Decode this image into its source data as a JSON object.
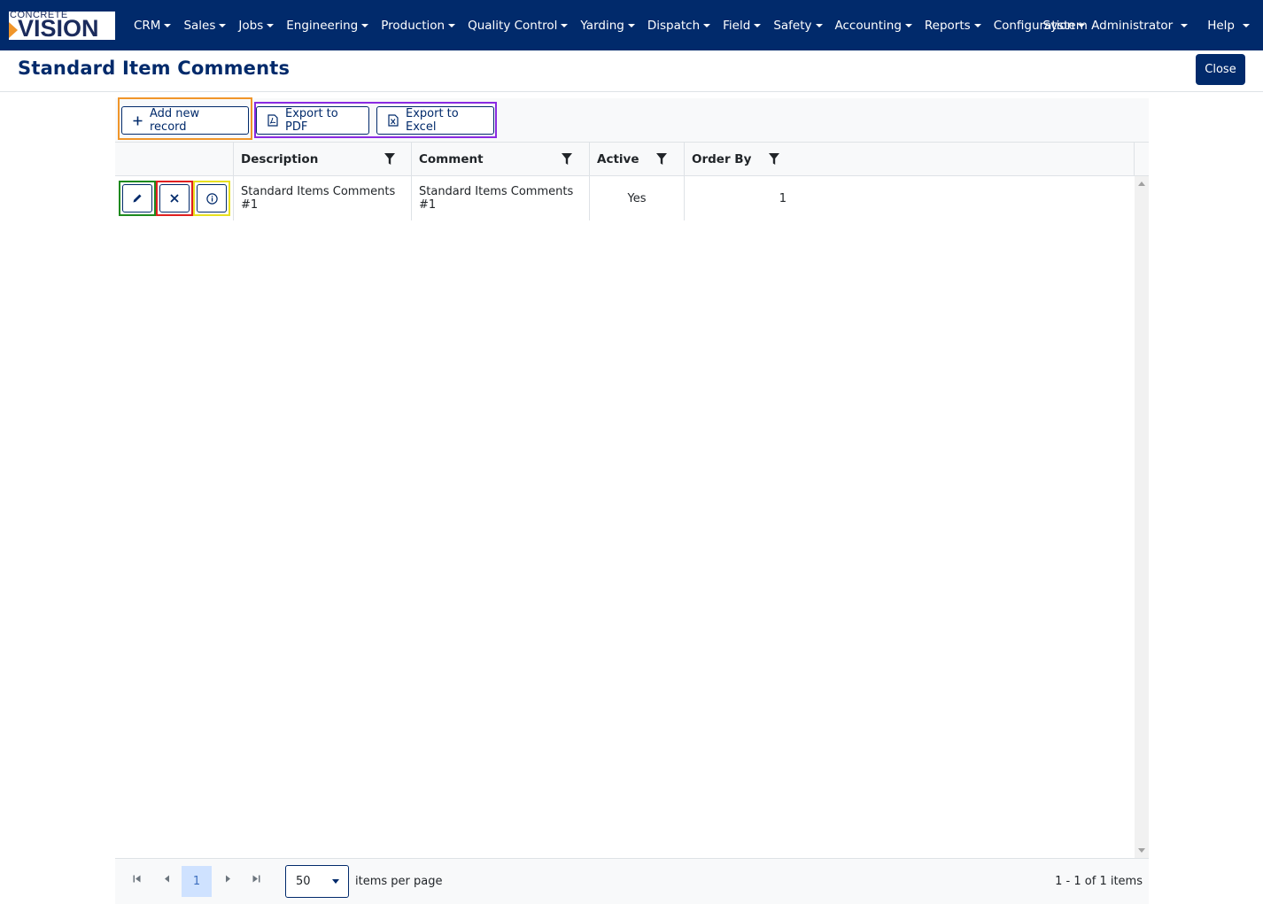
{
  "logo": {
    "top_text": "CONCRETE",
    "main_text": "VISION"
  },
  "nav": {
    "items": [
      {
        "label": "CRM"
      },
      {
        "label": "Sales"
      },
      {
        "label": "Jobs"
      },
      {
        "label": "Engineering"
      },
      {
        "label": "Production"
      },
      {
        "label": "Quality Control"
      },
      {
        "label": "Yarding"
      },
      {
        "label": "Dispatch"
      },
      {
        "label": "Field"
      },
      {
        "label": "Safety"
      },
      {
        "label": "Accounting"
      },
      {
        "label": "Reports"
      },
      {
        "label": "Configuration"
      }
    ],
    "user_label": "System Administrator",
    "help_label": "Help"
  },
  "page": {
    "title": "Standard Item Comments",
    "close_label": "Close"
  },
  "toolbar": {
    "add_label": "Add new record",
    "export_pdf_label": "Export to PDF",
    "export_excel_label": "Export to Excel"
  },
  "table": {
    "columns": [
      {
        "label": "Description"
      },
      {
        "label": "Comment"
      },
      {
        "label": "Active"
      },
      {
        "label": "Order By"
      }
    ],
    "rows": [
      {
        "description": "Standard Items Comments #1",
        "comment": "Standard Items Comments #1",
        "active": "Yes",
        "order_by": "1"
      }
    ]
  },
  "pager": {
    "current_page": "1",
    "page_size": "50",
    "items_per_page_label": "items per page",
    "info": "1 - 1 of 1 items"
  },
  "colors": {
    "brand_navy": "#012a6b",
    "logo_accent": "#f0952a",
    "highlight_add": "#f0952a",
    "highlight_export": "#8a2be2",
    "highlight_edit": "#1e8a1e",
    "highlight_delete": "#e02020",
    "highlight_info": "#e8e020"
  }
}
